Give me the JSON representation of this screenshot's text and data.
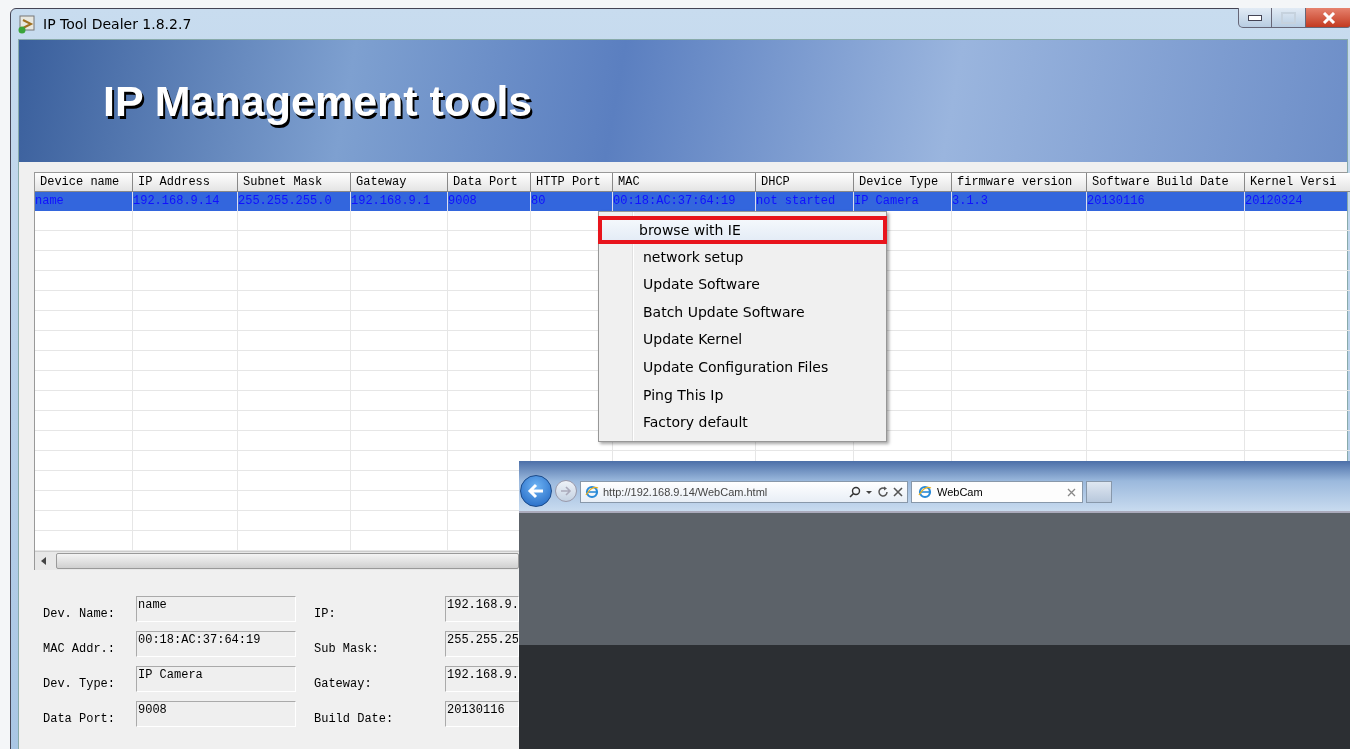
{
  "window": {
    "title": "IP Tool Dealer 1.8.2.7"
  },
  "banner": {
    "title": "IP Management tools"
  },
  "table": {
    "columns": [
      "Device name",
      "IP Address",
      "Subnet Mask",
      "Gateway",
      "Data Port",
      "HTTP Port",
      "MAC",
      "DHCP",
      "Device Type",
      "firmware version",
      "Software Build Date",
      "Kernel Versi"
    ],
    "rows": [
      {
        "selected": true,
        "cells": [
          "name",
          "192.168.9.14",
          "255.255.255.0",
          "192.168.9.1",
          "9008",
          "80",
          "00:18:AC:37:64:19",
          "not started",
          "IP Camera",
          "3.1.3",
          "20130116",
          "20120324"
        ]
      }
    ]
  },
  "context_menu": {
    "items": [
      {
        "label": "browse with IE",
        "selected": true
      },
      {
        "label": "network setup",
        "selected": false
      },
      {
        "label": "Update Software",
        "selected": false
      },
      {
        "label": "Batch Update Software",
        "selected": false
      },
      {
        "label": "Update Kernel",
        "selected": false
      },
      {
        "label": "Update Configuration Files",
        "selected": false
      },
      {
        "label": "Ping This Ip",
        "selected": false
      },
      {
        "label": "Factory default",
        "selected": false
      }
    ]
  },
  "details": {
    "left": [
      {
        "label": "Dev. Name:",
        "value": "name"
      },
      {
        "label": "MAC Addr.:",
        "value": "00:18:AC:37:64:19"
      },
      {
        "label": "Dev. Type:",
        "value": "IP Camera"
      },
      {
        "label": "Data Port:",
        "value": "9008"
      }
    ],
    "right": [
      {
        "label": "IP:",
        "value": "192.168.9."
      },
      {
        "label": "Sub Mask:",
        "value": "255.255.25"
      },
      {
        "label": "Gateway:",
        "value": "192.168.9."
      },
      {
        "label": "Build Date:",
        "value": "20130116"
      }
    ]
  },
  "browser": {
    "url": "http://192.168.9.14/WebCam.html",
    "tab_title": "WebCam"
  }
}
